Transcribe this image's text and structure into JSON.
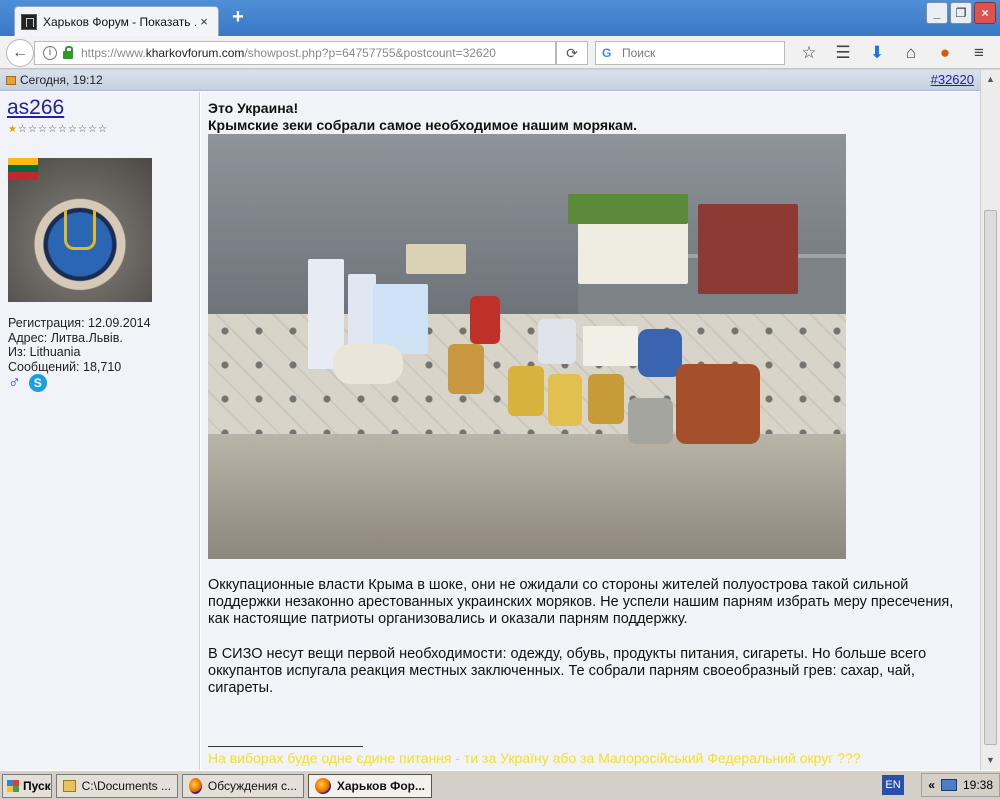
{
  "browser": {
    "tab_title": "Харьков Форум - Показать ...",
    "tab_close": "×",
    "new_tab": "+",
    "window_buttons": [
      "_",
      "❐",
      "×"
    ],
    "url_prefix": "https://www.",
    "url_domain": "kharkovforum.com",
    "url_rest": "/showpost.php?p=64757755&postcount=32620",
    "search_placeholder": "Поиск",
    "toolbar_icons": [
      "star-icon",
      "reading-list-icon",
      "download-icon",
      "home-icon",
      "pocket-icon",
      "menu-icon"
    ]
  },
  "post": {
    "date": "Сегодня, 19:12",
    "number": "#32620",
    "user": {
      "name": "as266",
      "stars_total": 10,
      "stars_on": 1,
      "registration": "Регистрация: 12.09.2014",
      "address": "Адрес: Литва.Львів.",
      "from": "Из: Lithuania",
      "messages": "Сообщений: 18,710"
    },
    "title1": "Это Украина!",
    "title2": "Крымские зеки собрали самое необходимое нашим морякам.",
    "paragraph1": "Оккупационные власти Крыма в шоке, они не ожидали со стороны жителей полуострова такой сильной поддержки незаконно арестованных украинских моряков. Не успели нашим парням избрать меру пресечения, как настоящие патриоты организовались и оказали парням поддержку.",
    "paragraph2": "В СИЗО несут вещи первой необходимости: одежду, обувь, продукты питания, сигареты. Но больше всего оккупантов испугала реакция местных заключенных. Те собрали парням своеобразный грев: сахар, чай, сигареты.",
    "signature": "На виборах буде одне єдине питання - ти за Україну або за Малоросійський Федеральний округ ???"
  },
  "taskbar": {
    "start": "Пуск",
    "tasks": [
      "C:\\Documents ...",
      "Обсуждения с...",
      "Харьков Фор..."
    ],
    "lang": "EN",
    "tray_arrow": "«",
    "time": "19:38"
  },
  "colors": {
    "signature": "#f0e02a",
    "link": "#22229c",
    "panel_bg": "#f1f3f8"
  }
}
